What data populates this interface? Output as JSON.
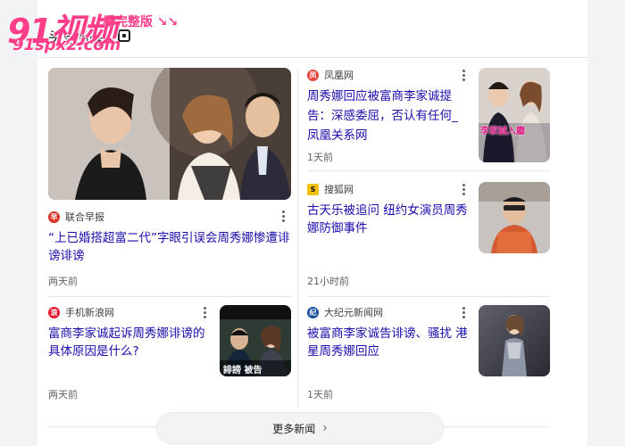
{
  "watermark": {
    "logo": "91视频",
    "tagline": "看完整版 ↘↘",
    "url": "91spx2.com"
  },
  "header": {
    "title": "头条新闻"
  },
  "stories": [
    {
      "source": "联合早报",
      "headline": "“上已婚搭超富二代”字眼引误会周秀娜惨遭诽谤诽谤",
      "time": "两天前"
    },
    {
      "source": "凤凰网",
      "headline": "周秀娜回应被富商李家诚提告：深感委屈，否认有任何_凤凰关系网",
      "time": "1天前",
      "thumb_caption": "李家誠入廳"
    },
    {
      "source": "搜狐网",
      "headline": "古天乐被追问 纽约女演员周秀娜防御事件",
      "time": "21小时前"
    },
    {
      "source": "手机新浪网",
      "headline": "富商李家诚起诉周秀娜诽谤的具体原因是什么?",
      "time": "两天前",
      "thumb_caption": "誹謗 被告"
    },
    {
      "source": "大纪元新闻网",
      "headline": "被富商李家诚告诽谤、骚扰 港星周秀娜回应",
      "time": "1天前"
    }
  ],
  "more_button": {
    "label": "更多新闻",
    "icon": "chevron-right-icon"
  },
  "colors": {
    "headline": "#1a0dab",
    "watermark": "#ff3e89"
  }
}
